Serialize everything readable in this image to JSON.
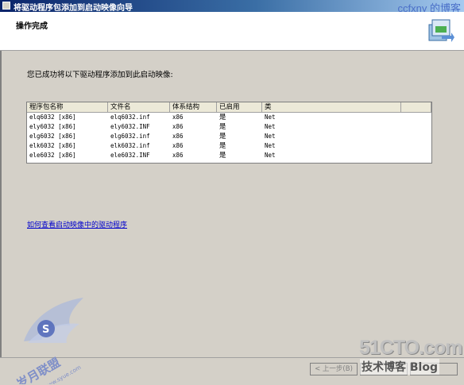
{
  "window": {
    "title": "将驱动程序包添加到启动映像向导",
    "watermark": "ccfxny 的博客"
  },
  "header": {
    "title": "操作完成"
  },
  "main": {
    "intro_text": "您已成功将以下驱动程序添加到此启动映像:",
    "columns": [
      "程序包名称",
      "文件名",
      "体系结构",
      "已启用",
      "类",
      ""
    ],
    "rows": [
      [
        "elq6032 [x86]",
        "elq6032.inf",
        "x86",
        "是",
        "Net"
      ],
      [
        "ely6032 [x86]",
        "ely6032.INF",
        "x86",
        "是",
        "Net"
      ],
      [
        "elg6032 [x86]",
        "elg6032.inf",
        "x86",
        "是",
        "Net"
      ],
      [
        "elk6032 [x86]",
        "elk6032.inf",
        "x86",
        "是",
        "Net"
      ],
      [
        "ele6032 [x86]",
        "ele6032.INF",
        "x86",
        "是",
        "Net"
      ]
    ],
    "help_link": "如何查看启动映像中的驱动程序"
  },
  "footer": {
    "back_label": "< 上一步(B)",
    "next_label": "",
    "cancel_label": ""
  },
  "watermarks": {
    "site": "51CTO.com",
    "blog": "技术博客  Blog",
    "logo_text": "岁月联盟",
    "logo_url": "www.syue.com"
  },
  "colors": {
    "title_gradient_start": "#0a246a",
    "title_gradient_end": "#a6caf0",
    "dialog_face": "#d4d0c8",
    "link": "#0000cc"
  }
}
